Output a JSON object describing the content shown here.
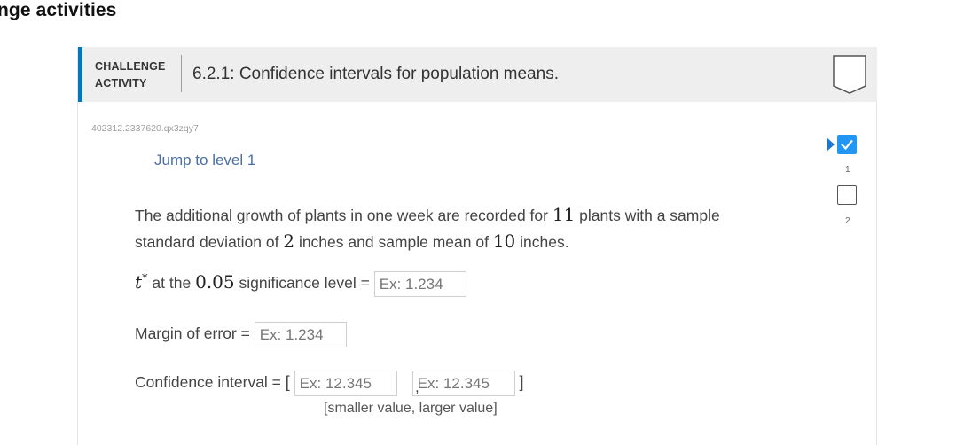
{
  "section": {
    "heading": "nge activities"
  },
  "activity": {
    "type_line1": "CHALLENGE",
    "type_line2": "ACTIVITY",
    "title": "6.2.1: Confidence intervals for population means.",
    "id": "402312.2337620.qx3zqy7",
    "jump_label": "Jump to level 1",
    "accent_color": "#0277bd"
  },
  "problem": {
    "p1": "The additional growth of plants in one week are recorded for ",
    "n_plants": "11",
    "p2": " plants with a sample standard deviation of ",
    "sd": "2",
    "p3": " inches and sample mean of ",
    "mean": "10",
    "p4": " inches."
  },
  "questions": {
    "tstar": {
      "symbol": "t",
      "star": "*",
      "pre": " at the ",
      "level": "0.05",
      "post": " significance level = ",
      "placeholder": "Ex: 1.234"
    },
    "margin": {
      "label": "Margin of error = ",
      "placeholder": "Ex: 1.234"
    },
    "ci": {
      "label": "Confidence interval = ",
      "open": "[",
      "comma": ",",
      "close": "]",
      "placeholder_low": "Ex: 12.345",
      "placeholder_high": "Ex: 12.345",
      "hint": "[smaller value, larger value]"
    }
  },
  "levels": [
    {
      "number": "1",
      "status": "completed",
      "current": true
    },
    {
      "number": "2",
      "status": "incomplete",
      "current": false
    }
  ]
}
